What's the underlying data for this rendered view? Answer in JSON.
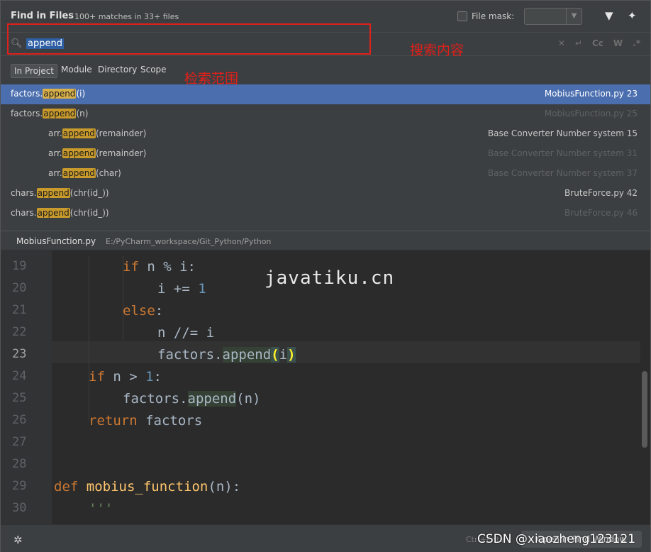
{
  "header": {
    "title": "Find in Files",
    "match_count": "100+ matches in 33+ files",
    "file_mask_label": "File mask:",
    "filter_icon": "filter-icon",
    "pin_icon": "pin-icon"
  },
  "search": {
    "query": "append",
    "case_label": "Cc",
    "word_label": "W",
    "regex_label": ".*"
  },
  "annotations": {
    "search_note": "搜索内容",
    "scope_note": "检索范围"
  },
  "scope": {
    "in_project": "In Project",
    "module": "Module",
    "directory": "Directory",
    "scope": "Scope"
  },
  "results": [
    {
      "prefix": "factors.",
      "match": "append",
      "suffix": "(i)",
      "file": "MobiusFunction.py 23",
      "selected": true
    },
    {
      "prefix": "factors.",
      "match": "append",
      "suffix": "(n)",
      "file": "MobiusFunction.py 25",
      "selected": false
    },
    {
      "prefix": "arr.",
      "match": "append",
      "suffix": "(remainder)",
      "file": "Base Converter Number system 15",
      "selected": false
    },
    {
      "prefix": "arr.",
      "match": "append",
      "suffix": "(remainder)",
      "file": "Base Converter Number system 31",
      "selected": false
    },
    {
      "prefix": "arr.",
      "match": "append",
      "suffix": "(char)",
      "file": "Base Converter Number system 37",
      "selected": false
    },
    {
      "prefix": "chars.",
      "match": "append",
      "suffix": "(chr(id_))",
      "file": "BruteForce.py 42",
      "selected": false
    },
    {
      "prefix": "chars.",
      "match": "append",
      "suffix": "(chr(id_))",
      "file": "BruteForce.py 46",
      "selected": false
    }
  ],
  "path_bar": {
    "file_name": "MobiusFunction.py",
    "path": "E:/PyCharm_workspace/Git_Python/Python"
  },
  "editor": {
    "line_numbers": [
      "19",
      "20",
      "21",
      "22",
      "23",
      "24",
      "25",
      "26",
      "27",
      "28",
      "29",
      "30"
    ],
    "current_line": "23",
    "watermark": "javatiku.cn"
  },
  "footer": {
    "shortcut": "Ctrl+Enter",
    "open_button": "Open in Find Window",
    "credit": "CSDN @xiaozheng123121"
  },
  "colors": {
    "selection": "#4b6eaf",
    "highlight": "#c89a2c",
    "annotation_red": "#e0201b"
  }
}
